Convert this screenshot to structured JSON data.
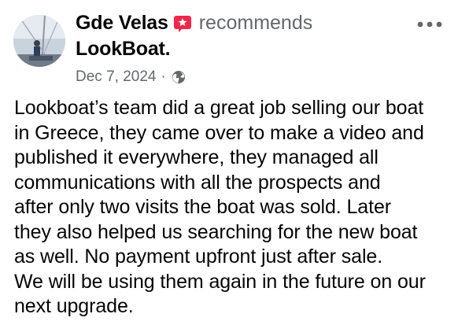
{
  "post": {
    "author": "Gde Velas",
    "recommends_label": "recommends",
    "page_name": "LookBoat",
    "page_suffix": ".",
    "date": "Dec 7, 2024",
    "separator": "·",
    "icons": {
      "recommend": "recommend-icon",
      "audience": "globe-icon",
      "more": "more-options-icon",
      "avatar": "avatar"
    },
    "colors": {
      "recommend_icon": "#f02849",
      "secondary_text": "#65676b",
      "primary_text": "#050505"
    },
    "body_lines": [
      "Lookboat’s team did a great job selling our boat",
      "in Greece, they came over to make a video and",
      "published it everywhere, they managed all",
      "communications with all the prospects and",
      "after only two visits the boat was sold. Later",
      "they also helped us searching for the new boat",
      "as well. No payment upfront just after sale.",
      "We will be using them again in the future on our",
      "next upgrade."
    ]
  }
}
